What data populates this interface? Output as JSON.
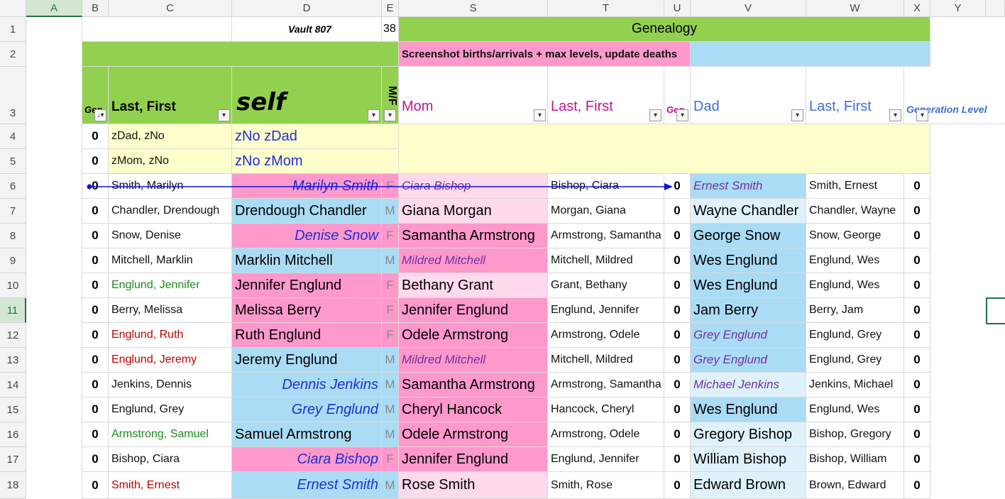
{
  "columns": [
    "A",
    "B",
    "C",
    "D",
    "E",
    "S",
    "T",
    "U",
    "V",
    "W",
    "X",
    "Y"
  ],
  "rows": [
    "1",
    "2",
    "3",
    "4",
    "5",
    "6",
    "7",
    "8",
    "9",
    "10",
    "11",
    "12",
    "13",
    "14",
    "15",
    "16",
    "17",
    "18"
  ],
  "header": {
    "vault": "Vault 807",
    "vault_count": "38",
    "genealogy": "Genealogy",
    "note": "Screenshot births/arrivals + max levels, update deaths",
    "gen_short": "Gen",
    "last_first": "Last, First",
    "self": "self",
    "mf": "M/F",
    "mom": "Mom",
    "mom_last_first": "Last, First",
    "gen_short2": "Gen",
    "dad": "Dad",
    "dad_last_first": "Last, First",
    "generation_level": "Generation Level"
  },
  "placeholder_rows": [
    {
      "gen": "0",
      "last_first": "zDad, zNo",
      "self": "zNo zDad"
    },
    {
      "gen": "0",
      "last_first": "zMom, zNo",
      "self": "zNo zMom"
    }
  ],
  "records": [
    {
      "gen": "0",
      "last_first": "Smith, Marilyn",
      "self": "Marilyn Smith",
      "mf": "F",
      "mom": "Ciara Bishop",
      "mom_lf": "Bishop, Ciara",
      "mom_gen": "0",
      "dad": "Ernest Smith",
      "dad_lf": "Smith, Ernest",
      "dad_gen": "0"
    },
    {
      "gen": "0",
      "last_first": "Chandler, Drendough",
      "self": "Drendough Chandler",
      "mf": "M",
      "mom": "Giana Morgan",
      "mom_lf": "Morgan, Giana",
      "mom_gen": "0",
      "dad": "Wayne Chandler",
      "dad_lf": "Chandler, Wayne",
      "dad_gen": "0"
    },
    {
      "gen": "0",
      "last_first": "Snow, Denise",
      "self": "Denise Snow",
      "mf": "F",
      "mom": "Samantha Armstrong",
      "mom_lf": "Armstrong, Samantha",
      "mom_gen": "0",
      "dad": "George Snow",
      "dad_lf": "Snow, George",
      "dad_gen": "0"
    },
    {
      "gen": "0",
      "last_first": "Mitchell, Marklin",
      "self": "Marklin Mitchell",
      "mf": "M",
      "mom": "Mildred Mitchell",
      "mom_lf": "Mitchell, Mildred",
      "mom_gen": "0",
      "dad": "Wes Englund",
      "dad_lf": "Englund, Wes",
      "dad_gen": "0"
    },
    {
      "gen": "0",
      "last_first": "Englund, Jennifer",
      "self": "Jennifer Englund",
      "mf": "F",
      "mom": "Bethany Grant",
      "mom_lf": "Grant, Bethany",
      "mom_gen": "0",
      "dad": "Wes Englund",
      "dad_lf": "Englund, Wes",
      "dad_gen": "0"
    },
    {
      "gen": "0",
      "last_first": "Berry, Melissa",
      "self": "Melissa Berry",
      "mf": "F",
      "mom": "Jennifer Englund",
      "mom_lf": "Englund, Jennifer",
      "mom_gen": "0",
      "dad": "Jam Berry",
      "dad_lf": "Berry, Jam",
      "dad_gen": "0"
    },
    {
      "gen": "0",
      "last_first": "Englund, Ruth",
      "self": "Ruth Englund",
      "mf": "F",
      "mom": "Odele Armstrong",
      "mom_lf": "Armstrong, Odele",
      "mom_gen": "0",
      "dad": "Grey Englund",
      "dad_lf": "Englund, Grey",
      "dad_gen": "0"
    },
    {
      "gen": "0",
      "last_first": "Englund, Jeremy",
      "self": "Jeremy Englund",
      "mf": "M",
      "mom": "Mildred Mitchell",
      "mom_lf": "Mitchell, Mildred",
      "mom_gen": "0",
      "dad": "Grey Englund",
      "dad_lf": "Englund, Grey",
      "dad_gen": "0"
    },
    {
      "gen": "0",
      "last_first": "Jenkins, Dennis",
      "self": "Dennis Jenkins",
      "mf": "M",
      "mom": "Samantha Armstrong",
      "mom_lf": "Armstrong, Samantha",
      "mom_gen": "0",
      "dad": "Michael Jenkins",
      "dad_lf": "Jenkins, Michael",
      "dad_gen": "0"
    },
    {
      "gen": "0",
      "last_first": "Englund, Grey",
      "self": "Grey Englund",
      "mf": "M",
      "mom": "Cheryl Hancock",
      "mom_lf": "Hancock, Cheryl",
      "mom_gen": "0",
      "dad": "Wes Englund",
      "dad_lf": "Englund, Wes",
      "dad_gen": "0"
    },
    {
      "gen": "0",
      "last_first": "Armstrong, Samuel",
      "self": "Samuel Armstrong",
      "mf": "M",
      "mom": "Odele Armstrong",
      "mom_lf": "Armstrong, Odele",
      "mom_gen": "0",
      "dad": "Gregory Bishop",
      "dad_lf": "Bishop, Gregory",
      "dad_gen": "0"
    },
    {
      "gen": "0",
      "last_first": "Bishop, Ciara",
      "self": "Ciara Bishop",
      "mf": "F",
      "mom": "Jennifer Englund",
      "mom_lf": "Englund, Jennifer",
      "mom_gen": "0",
      "dad": "William Bishop",
      "dad_lf": "Bishop, William",
      "dad_gen": "0"
    },
    {
      "gen": "0",
      "last_first": "Smith, Ernest",
      "self": "Ernest Smith",
      "mf": "M",
      "mom": "Rose Smith",
      "mom_lf": "Smith, Rose",
      "mom_gen": "0",
      "dad": "Edward Brown",
      "dad_lf": "Brown, Edward",
      "dad_gen": "0"
    }
  ],
  "colors": {
    "selection": "#217346",
    "female": "#ff99cc",
    "male": "#aadcf5",
    "header_green": "#92d050"
  }
}
